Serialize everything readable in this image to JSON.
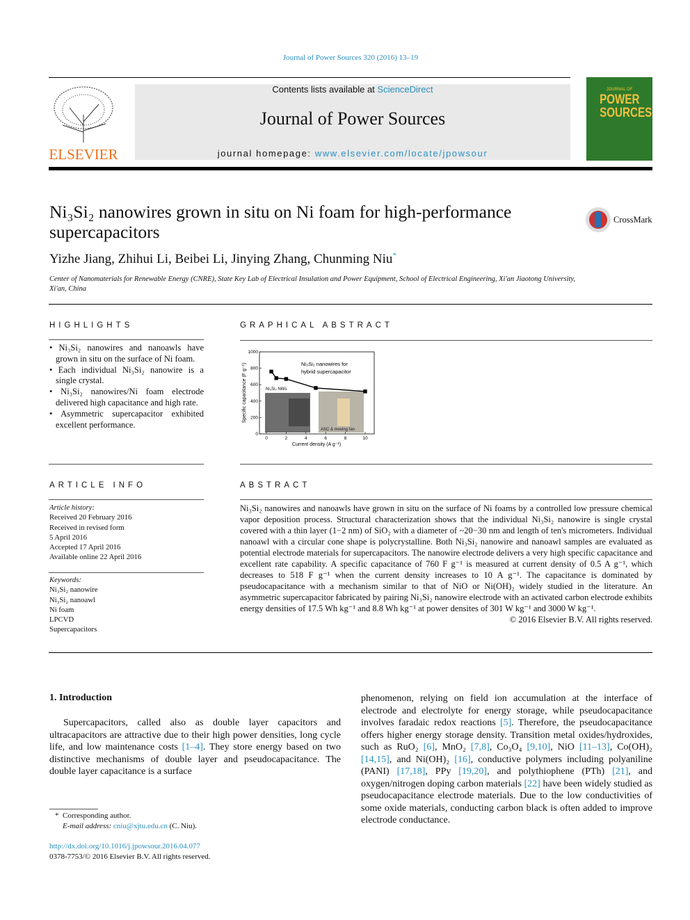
{
  "journal_ref": "Journal of Power Sources 320 (2016) 13–19",
  "header": {
    "contents_prefix": "Contents lists available at ",
    "contents_link": "ScienceDirect",
    "journal_title": "Journal of Power Sources",
    "homepage_prefix": "journal homepage: ",
    "homepage_link": "www.elsevier.com/locate/jpowsour",
    "publisher_logo": "ELSEVIER",
    "cover_text": "POWER SOURCES",
    "cover_top": "JOURNAL OF"
  },
  "article": {
    "title": "Ni₃Si₂ nanowires grown in situ on Ni foam for high-performance supercapacitors",
    "authors": "Yizhe Jiang, Zhihui Li, Beibei Li, Jinying Zhang, Chunming Niu",
    "corresponding_mark": "*",
    "affiliation": "Center of Nanomaterials for Renewable Energy (CNRE), State Key Lab of Electrical Insulation and Power Equipment, School of Electrical Engineering, Xi'an Jiaotong University, Xi'an, China",
    "crossmark": "CrossMark"
  },
  "highlights": {
    "heading": "HIGHLIGHTS",
    "items": [
      "Ni₃Si₂ nanowires and nanoawls have grown in situ on the surface of Ni foam.",
      "Each individual Ni₃Si₂ nanowire is a single crystal.",
      "Ni₃Si₂ nanowires/Ni foam electrode delivered high capacitance and high rate.",
      "Asymmetric supercapacitor exhibited excellent performance."
    ]
  },
  "graphical_abstract": {
    "heading": "GRAPHICAL ABSTRACT",
    "annotation": [
      "Ni₃Si₂ nanowires for",
      "hybrid supercapacitor"
    ],
    "inset_left_label": "Ni₃Si₂ NWs",
    "inset_right_label": "ASC & moving fan"
  },
  "chart_data": {
    "type": "line",
    "x": [
      0.5,
      1,
      2,
      5,
      10
    ],
    "values": [
      760,
      680,
      670,
      560,
      518
    ],
    "xlabel": "Current density (A g⁻¹)",
    "ylabel": "Specific capacitance (F g⁻¹)",
    "xlim": [
      -0.5,
      10.5
    ],
    "ylim": [
      0,
      1000
    ],
    "xticks": [
      "0",
      "2",
      "4",
      "6",
      "8",
      "10"
    ],
    "yticks": [
      "0",
      "200",
      "400",
      "600",
      "800",
      "1000"
    ],
    "marker": "square",
    "color": "#000000"
  },
  "article_info": {
    "heading": "ARTICLE INFO",
    "history_label": "Article history:",
    "history": [
      "Received 20 February 2016",
      "Received in revised form",
      "5 April 2016",
      "Accepted 17 April 2016",
      "Available online 22 April 2016"
    ],
    "keywords_label": "Keywords:",
    "keywords": [
      "Ni₃Si₂ nanowire",
      "Ni₃Si₂ nanoawl",
      "Ni foam",
      "LPCVD",
      "Supercapacitors"
    ]
  },
  "abstract": {
    "heading": "ABSTRACT",
    "text": "Ni₃Si₂ nanowires and nanoawls have grown in situ on the surface of Ni foams by a controlled low pressure chemical vapor deposition process. Structural characterization shows that the individual Ni₃Si₂ nanowire is single crystal covered with a thin layer (1−2 nm) of SiO₂ with a diameter of ~20−30 nm and length of ten's micrometers. Individual nanoawl with a circular cone shape is polycrystalline. Both Ni₃Si₂ nanowire and nanoawl samples are evaluated as potential electrode materials for supercapacitors. The nanowire electrode delivers a very high specific capacitance and excellent rate capability. A specific capacitance of 760 F g⁻¹ is measured at current density of 0.5 A g⁻¹, which decreases to 518 F g⁻¹ when the current density increases to 10 A g⁻¹. The capacitance is dominated by pseudocapacitance with a mechanism similar to that of NiO or Ni(OH)₂ widely studied in the literature. An asymmetric supercapacitor fabricated by pairing Ni₃Si₂ nanowire electrode with an activated carbon electrode exhibits energy densities of 17.5 Wh kg⁻¹ and 8.8 Wh kg⁻¹ at power densites of 301 W kg⁻¹ and 3000 W kg⁻¹.",
    "copyright": "© 2016 Elsevier B.V. All rights reserved."
  },
  "intro": {
    "heading": "1.  Introduction",
    "left": [
      [
        "Supercapacitors, called also as double layer capacitors and ultracapacitors are attractive due to their high power densities, long cycle life, and low maintenance costs ",
        {
          "ref": "[1–4]"
        },
        ". They store energy based on two distinctive mechanisms of double layer and pseudocapacitance. The double layer capacitance is a surface"
      ]
    ],
    "right": [
      [
        "phenomenon, relying on field ion accumulation at the interface of electrode and electrolyte for energy storage, while pseudocapacitance involves faradaic redox reactions ",
        {
          "ref": "[5]"
        },
        ". Therefore, the pseudocapacitance offers higher energy storage density. Transition metal oxides/hydroxides, such as RuO₂ ",
        {
          "ref": "[6]"
        },
        ", MnO₂ ",
        {
          "ref": "[7,8]"
        },
        ", Co₃O₄ ",
        {
          "ref": "[9,10]"
        },
        ", NiO ",
        {
          "ref": "[11–13]"
        },
        ", Co(OH)₂ ",
        {
          "ref": "[14,15]"
        },
        ", and Ni(OH)₂ ",
        {
          "ref": "[16]"
        },
        ", conductive polymers including polyaniline (PANI) ",
        {
          "ref": "[17,18]"
        },
        ", PPy ",
        {
          "ref": "[19,20]"
        },
        ", and polythiophene (PTh) ",
        {
          "ref": "[21]"
        },
        ", and oxygen/nitrogen doping carbon materials ",
        {
          "ref": "[22]"
        },
        " have been widely studied as pseudocapacitance electrode materials. Due to the low conductivities of some oxide materials, conducting carbon black is often added to improve electrode conductance."
      ]
    ]
  },
  "footnote": {
    "mark": "*",
    "corresponding": "Corresponding author.",
    "email_label": "E-mail address: ",
    "email": "cniu@xjtu.edu.cn",
    "email_suffix": " (C. Niu).",
    "doi": "http://dx.doi.org/10.1016/j.jpowsour.2016.04.077",
    "issn": "0378-7753/© 2016 Elsevier B.V. All rights reserved."
  }
}
